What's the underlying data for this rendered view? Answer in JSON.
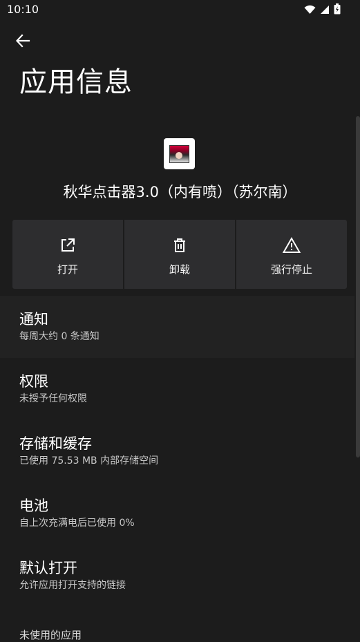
{
  "status_bar": {
    "time": "10:10",
    "icons": [
      "wifi-icon",
      "signal-icon",
      "battery-charging-icon"
    ]
  },
  "header": {
    "back_icon": "arrow-left-icon",
    "title": "应用信息"
  },
  "app": {
    "name": "秋华点击器3.0（内有喷）（苏尔南）"
  },
  "actions": [
    {
      "label": "打开",
      "icon": "open-in-new-icon"
    },
    {
      "label": "卸载",
      "icon": "trash-icon"
    },
    {
      "label": "强行停止",
      "icon": "warning-icon"
    }
  ],
  "items": [
    {
      "title": "通知",
      "subtitle": "每周大约 0 条通知"
    },
    {
      "title": "权限",
      "subtitle": "未授予任何权限"
    },
    {
      "title": "存储和缓存",
      "subtitle": "已使用 75.53 MB 内部存储空间"
    },
    {
      "title": "电池",
      "subtitle": "自上次充满电后已使用 0%"
    },
    {
      "title": "默认打开",
      "subtitle": "允许应用打开支持的链接"
    }
  ],
  "section": {
    "unused_apps": "未使用的应用"
  }
}
